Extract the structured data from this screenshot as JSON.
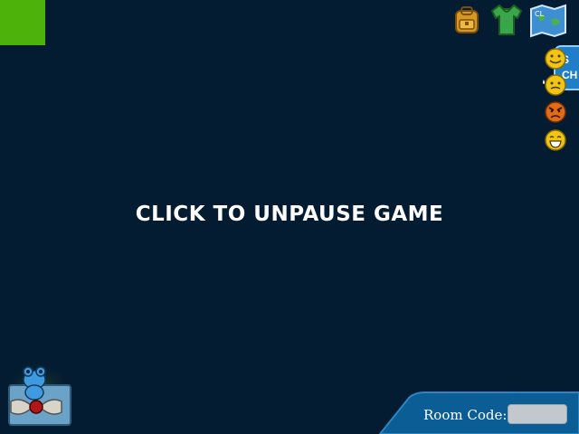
{
  "pause_overlay": {
    "message": "CLICK TO UNPAUSE GAME"
  },
  "side_panel": {
    "tab_text_line1": "S",
    "tab_text_line2": "CH"
  },
  "room": {
    "label": "Room Code:",
    "code_value": ""
  },
  "top_icons": [
    "backpack-icon",
    "shirt-icon",
    "map-icon"
  ],
  "emotes": [
    "happy-emote-icon",
    "sweat-emote-icon",
    "angry-emote-icon",
    "laugh-emote-icon"
  ],
  "colors": {
    "background": "#041c31",
    "green_square": "#4db30a",
    "panel_blue": "#1f7ec7",
    "room_panel": "#0b5e95"
  }
}
